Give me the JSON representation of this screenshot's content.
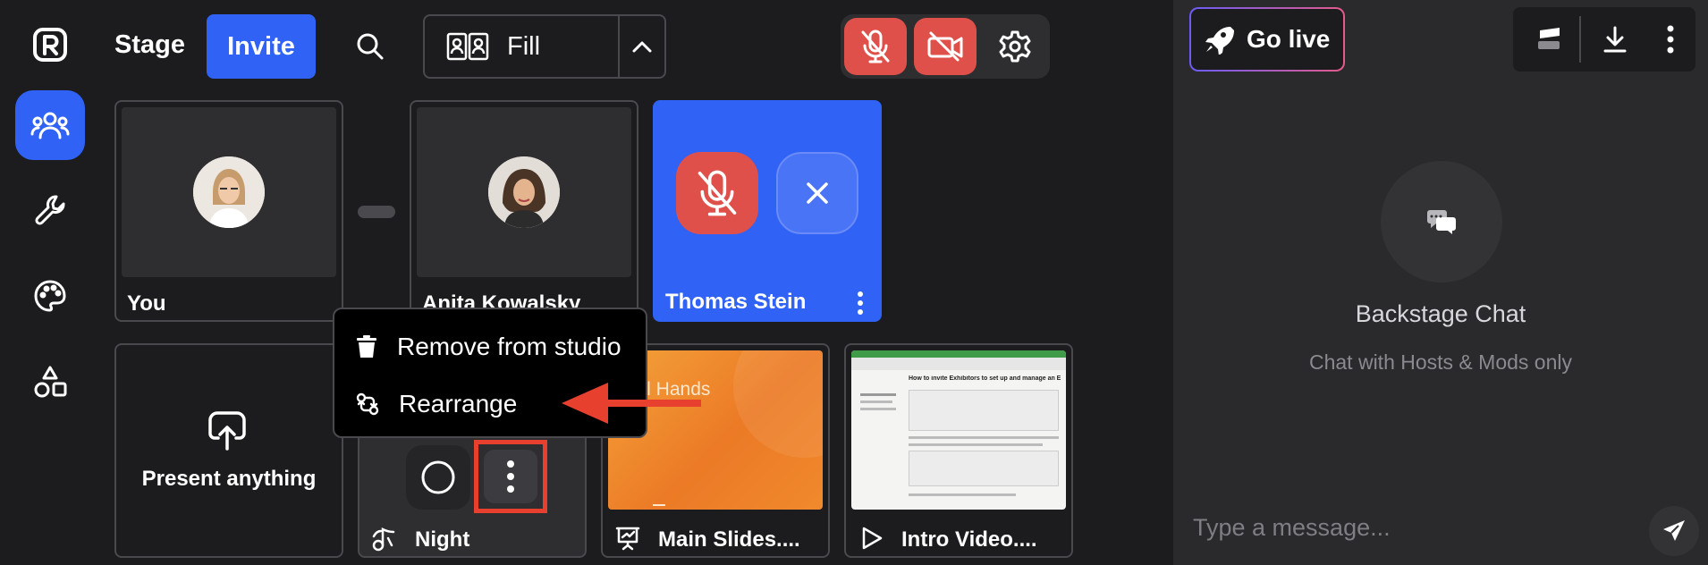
{
  "header": {
    "stage_label": "Stage",
    "invite_label": "Invite",
    "layout_label": "Fill"
  },
  "tiles": {
    "you": "You",
    "anita": "Anita Kowalsky",
    "thomas": "Thomas Stein",
    "present": "Present anything",
    "night": "Night",
    "slides": "Main Slides....",
    "slides_preview_text": "t All Hands",
    "video": "Intro Video....",
    "video_preview_title": "How to invite Exhibitors to set up and manage an Expo Booth"
  },
  "context_menu": {
    "remove": "Remove from studio",
    "rearrange": "Rearrange"
  },
  "right_panel": {
    "go_live": "Go live",
    "chat_title": "Backstage Chat",
    "chat_subtitle": "Chat with Hosts & Mods only",
    "message_placeholder": "Type a message..."
  },
  "colors": {
    "accent": "#2f62f5",
    "danger": "#e0504b",
    "annotation": "#e8402e",
    "background": "#1c1c1f",
    "panel": "#2a2a2d"
  },
  "icons": [
    "logo-icon",
    "people-icon",
    "wrench-icon",
    "palette-icon",
    "shapes-icon",
    "search-icon",
    "layout-icon",
    "chevron-up-icon",
    "mic-off-icon",
    "camera-off-icon",
    "gear-icon",
    "close-icon",
    "more-icon",
    "trash-icon",
    "rearrange-icon",
    "upload-icon",
    "circle-icon",
    "music-icon",
    "presentation-icon",
    "play-icon",
    "rocket-icon",
    "banner-icon",
    "download-icon",
    "chat-icon",
    "send-icon"
  ]
}
